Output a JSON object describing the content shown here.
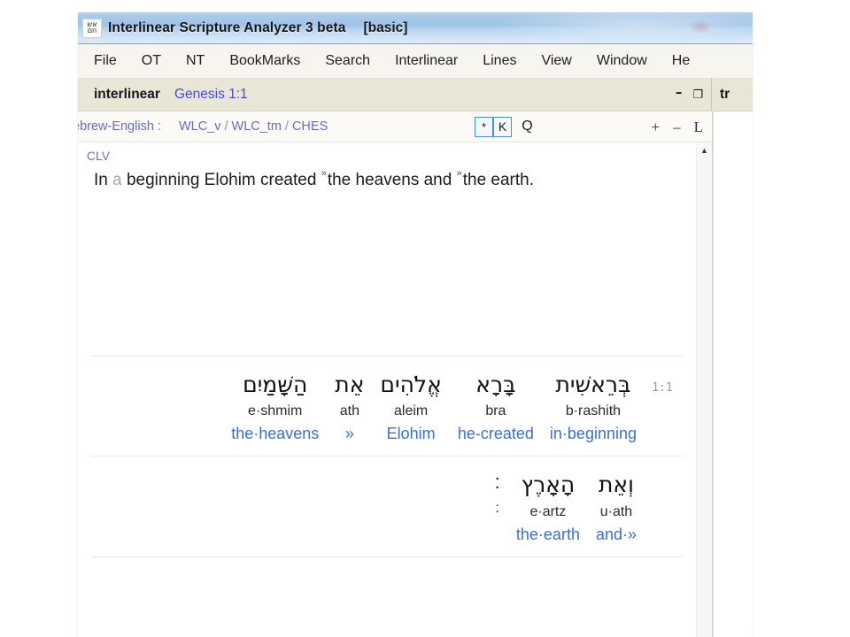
{
  "window": {
    "title": "Interlinear Scripture Analyzer 3 beta",
    "mode": "[basic]",
    "icon_glyph_top": "אש",
    "icon_glyph_bottom": "חם"
  },
  "menu": {
    "items": [
      {
        "label": "File"
      },
      {
        "label": "OT"
      },
      {
        "label": "NT"
      },
      {
        "label": "BookMarks"
      },
      {
        "label": "Search"
      },
      {
        "label": "Interlinear"
      },
      {
        "label": "Lines"
      },
      {
        "label": "View"
      },
      {
        "label": "Window"
      },
      {
        "label": "He"
      }
    ]
  },
  "tabs": {
    "interlinear": {
      "name": "interlinear",
      "reference": "Genesis 1:1",
      "minimize": "–",
      "restore": "❐"
    },
    "translation": {
      "name": "tr"
    }
  },
  "source_bar": {
    "pair_label": "ebrew-English :",
    "versions": [
      "WLC_v",
      "WLC_tm",
      "CHES"
    ],
    "separator": "/",
    "mode_buttons": [
      {
        "label": "*",
        "selected": true
      },
      {
        "label": "K",
        "selected": true
      },
      {
        "label": "Q",
        "selected": false
      }
    ],
    "zoom_controls": [
      {
        "label": "+"
      },
      {
        "label": "–"
      },
      {
        "label": "L"
      }
    ]
  },
  "translation_block": {
    "tag": "CLV",
    "text_parts": [
      {
        "t": "In ",
        "style": "normal"
      },
      {
        "t": "a",
        "style": "dim"
      },
      {
        "t": " beginning Elohim created ",
        "style": "normal"
      },
      {
        "t": "»",
        "style": "mark"
      },
      {
        "t": "the heavens and ",
        "style": "normal"
      },
      {
        "t": "»",
        "style": "mark"
      },
      {
        "t": "the earth.",
        "style": "normal"
      }
    ],
    "text_plain": "In a beginning Elohim created »the heavens and »the earth."
  },
  "interlinear": {
    "rows": [
      {
        "verse_ref": "1:1",
        "words": [
          {
            "hebrew": "בְּרֵאשִׁית",
            "translit": "b·rashith",
            "gloss": "in·beginning"
          },
          {
            "hebrew": "בָּרָא",
            "translit": "bra",
            "gloss": "he-created"
          },
          {
            "hebrew": "אֱלֹהִים",
            "translit": "aleim",
            "gloss": "Elohim"
          },
          {
            "hebrew": "אֵת",
            "translit": "ath",
            "gloss": "»"
          },
          {
            "hebrew": "הַשָּׁמַיִם",
            "translit": "e·shmim",
            "gloss": "the·heavens"
          }
        ]
      },
      {
        "verse_ref": "",
        "words": [
          {
            "hebrew": "וְאֵת",
            "translit": "u·ath",
            "gloss": "and·»"
          },
          {
            "hebrew": "הָאָרֶץ",
            "translit": "e·artz",
            "gloss": "the·earth"
          },
          {
            "hebrew": "׃",
            "translit": ":",
            "gloss": "",
            "punct": true
          }
        ]
      }
    ]
  },
  "scrollbar": {
    "up_arrow": "▲"
  },
  "colors": {
    "title_bar_blue": "#9fc3e6",
    "tab_beige": "#e9e6d6",
    "gloss_blue": "#3b6fd4",
    "link_purple": "#6a6ad0",
    "ref_blue": "#4a4ad6",
    "rule_gray": "#e7e7ec"
  }
}
